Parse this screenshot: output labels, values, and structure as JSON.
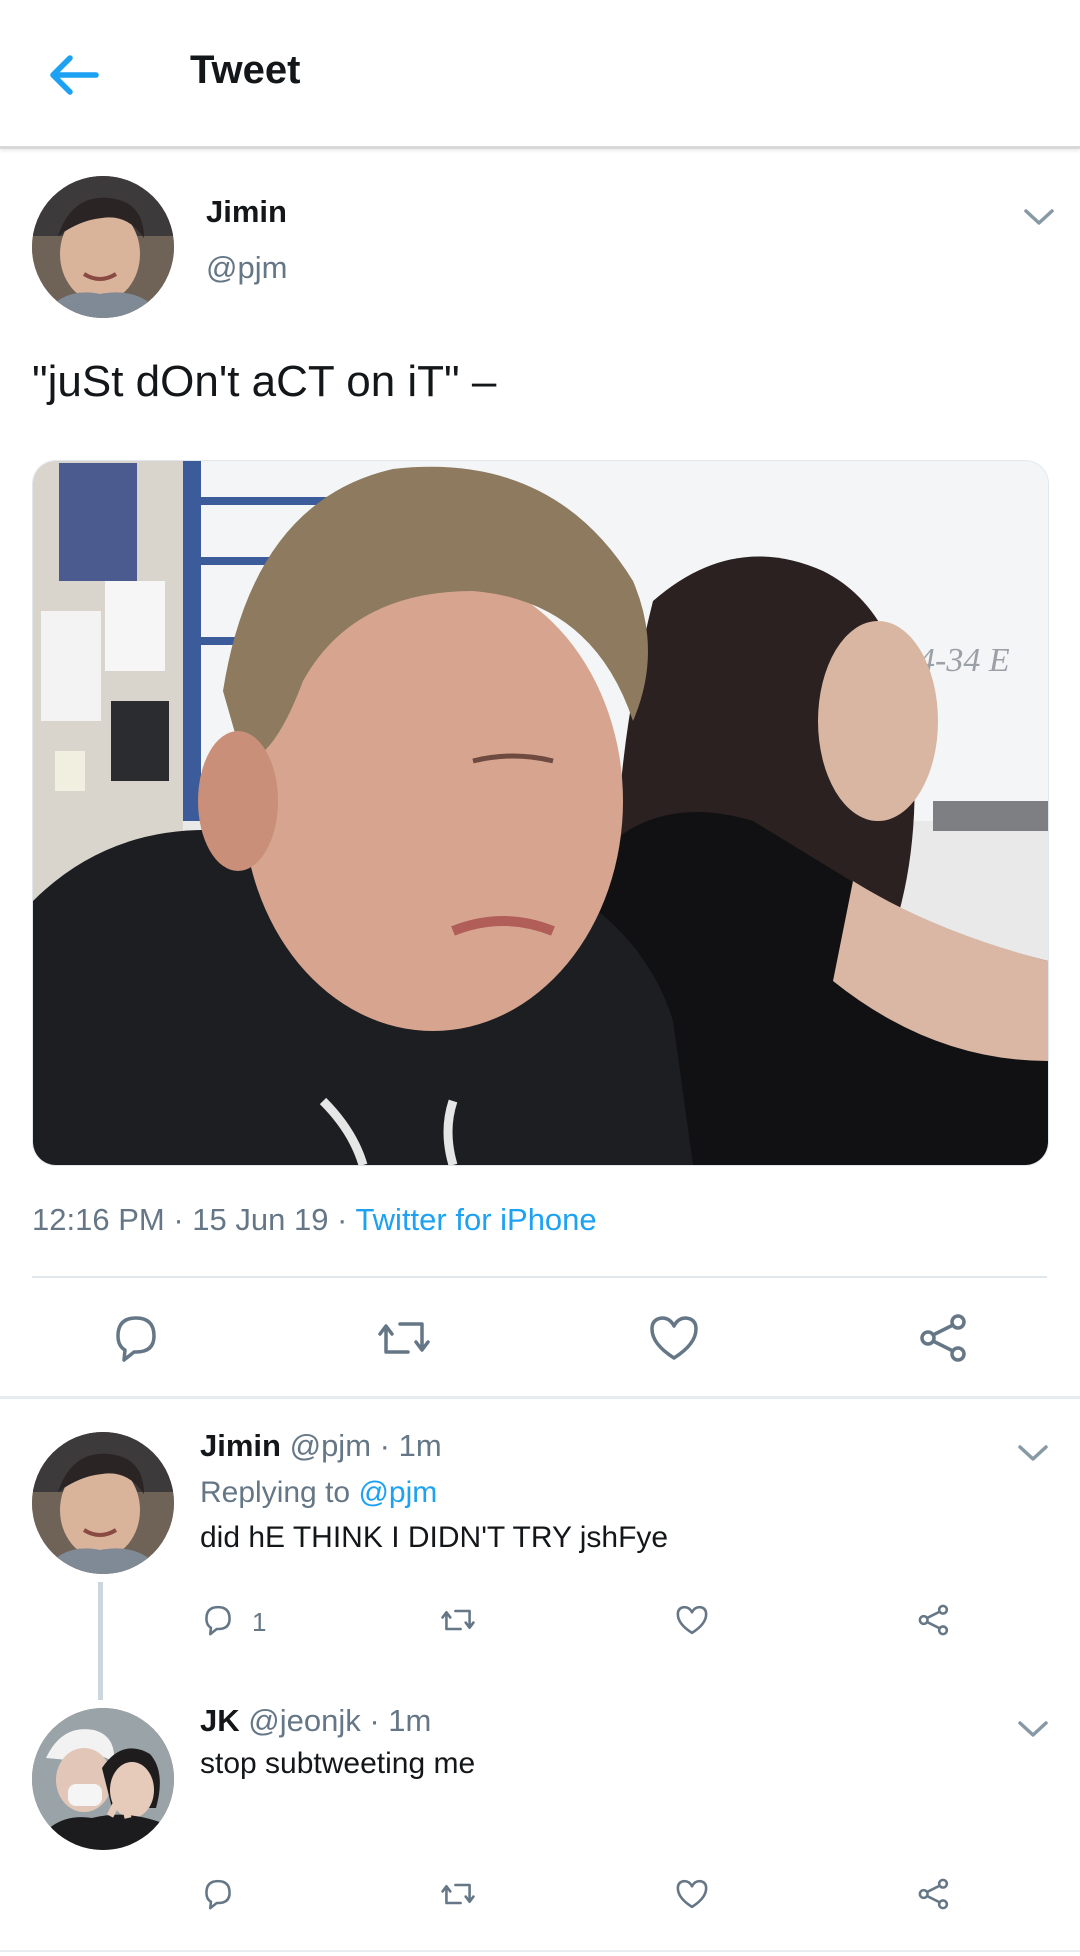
{
  "header": {
    "title": "Tweet"
  },
  "tweet": {
    "author_name": "Jimin",
    "author_handle": "@pjm",
    "text": "\"juSt dOn't aCT on iT\" –",
    "time": "12:16 PM",
    "date": "15 Jun 19",
    "separator": " · ",
    "source": "Twitter for iPhone",
    "media_whiteboard_text": "4-34 E"
  },
  "replies": [
    {
      "name": "Jimin",
      "handle": "@pjm",
      "age": "1m",
      "separator": " · ",
      "replying_prefix": "Replying to ",
      "replying_to": "@pjm",
      "text": "did hE THINK I DIDN'T TRY jshFye",
      "reply_count": "1"
    },
    {
      "name": "JK",
      "handle": "@jeonjk",
      "age": "1m",
      "separator": " · ",
      "text": "stop subtweeting me"
    }
  ],
  "colors": {
    "accent": "#1da1f2",
    "secondary_text": "#657786",
    "icon_gray": "#657786"
  },
  "icons": [
    "back-arrow-icon",
    "chevron-down-icon",
    "reply-icon",
    "retweet-icon",
    "like-icon",
    "share-icon"
  ]
}
